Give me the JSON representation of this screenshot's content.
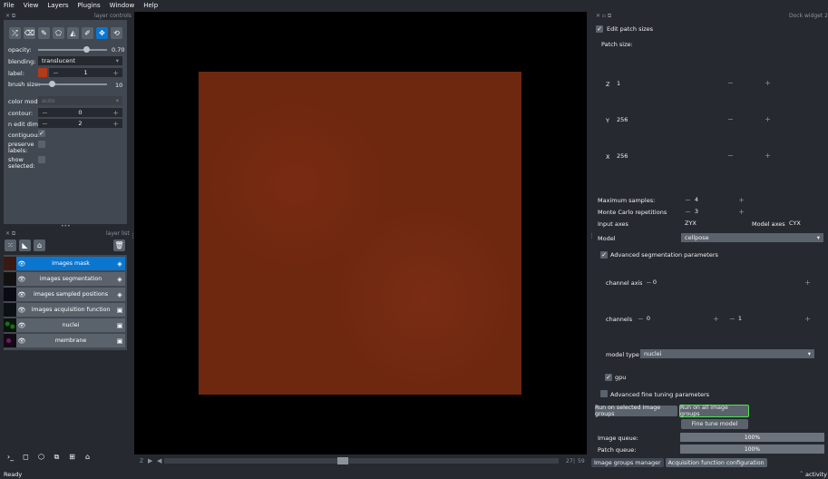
{
  "menu": [
    "File",
    "View",
    "Layers",
    "Plugins",
    "Window",
    "Help"
  ],
  "layer_controls": {
    "title": "layer controls",
    "opacity_label": "opacity:",
    "opacity_value": "0.70",
    "opacity_fraction": 0.7,
    "blending_label": "blending:",
    "blending_value": "translucent",
    "label_label": "label:",
    "label_value": "1",
    "label_color": "#b33a1a",
    "brush_label": "brush size:",
    "brush_value": "10",
    "brush_fraction": 0.2,
    "color_mode_label": "color mode:",
    "color_mode_value": "auto",
    "contour_label": "contour:",
    "contour_value": "0",
    "n_edit_label": "n edit dim:",
    "n_edit_value": "2",
    "contiguous_label": "contiguous:",
    "preserve_label": "preserve labels:",
    "show_selected_label": "show selected:"
  },
  "layer_list": {
    "title": "layer list",
    "layers": [
      {
        "name": "images mask",
        "selected": true
      },
      {
        "name": "images segmentation",
        "selected": false
      },
      {
        "name": "images sampled positions",
        "selected": false
      },
      {
        "name": "images acquisition function",
        "selected": false
      },
      {
        "name": "nuclei",
        "selected": false
      },
      {
        "name": "membrane",
        "selected": false
      }
    ]
  },
  "viewer": {
    "slider_left": "27",
    "slider_right": "59",
    "frame_label": "Z"
  },
  "dock": {
    "title": "Dock widget 2",
    "edit_patch_label": "Edit patch sizes",
    "patch_size_label": "Patch size:",
    "z_label": "Z",
    "z_value": "1",
    "y_label": "Y",
    "y_value": "256",
    "x_label": "X",
    "x_value": "256",
    "max_samples_label": "Maximum samples:",
    "max_samples_value": "4",
    "mc_label": "Monte Carlo repetitions",
    "mc_value": "3",
    "input_axes_label": "Input axes",
    "input_axes_value": "ZYX",
    "model_axes_label": "Model axes",
    "model_axes_value": "CYX",
    "model_label": "Model",
    "model_value": "cellpose",
    "adv_seg_label": "Advanced segmentation parameters",
    "channel_axis_label": "channel axis",
    "channel_axis_value": "0",
    "channels_label": "channels",
    "channel_1": "0",
    "channel_2": "1",
    "model_type_label": "model type",
    "model_type_value": "nuclei",
    "gpu_label": "gpu",
    "adv_ft_label": "Advanced fine tuning parameters",
    "run_selected": "Run on selected image groups",
    "run_all": "Run on all image groups",
    "fine_tune": "Fine tune model",
    "image_queue_label": "Image queue:",
    "image_queue_value": "100%",
    "patch_queue_label": "Patch queue:",
    "patch_queue_value": "100%"
  },
  "tabs": [
    "Image groups manager",
    "Acquisition function configuration"
  ],
  "status": {
    "left": "Ready",
    "right": "activity"
  }
}
